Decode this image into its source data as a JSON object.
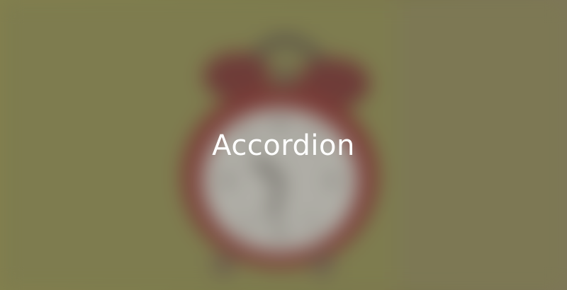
{
  "hero": {
    "title": "Accordion",
    "background_image": "blurred-alarm-clock",
    "colors": {
      "background": "#8e8a56",
      "clock_body": "#8a3a36",
      "clock_face": "#d8d6cf",
      "title_text": "#ffffff"
    }
  }
}
